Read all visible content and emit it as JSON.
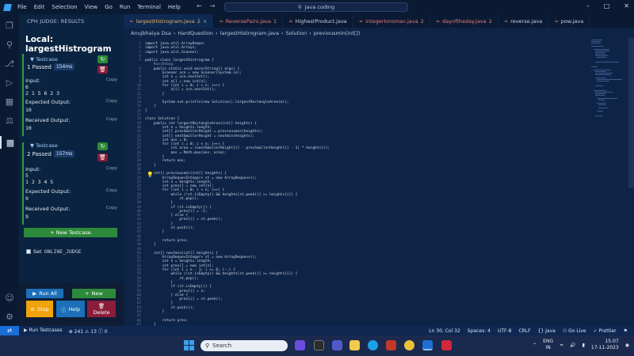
{
  "menu": [
    "File",
    "Edit",
    "Selection",
    "View",
    "Go",
    "Run",
    "Terminal",
    "Help"
  ],
  "search_text": "Java coding",
  "sidebar": {
    "header": "CPH JUDGE: RESULTS",
    "title": "Local: largestHistrogram",
    "testcases": [
      {
        "label": "Testcase",
        "status": "1 Passed",
        "time": "154ms",
        "input_label": "Input:",
        "input": [
          "6",
          "2 1 5 6 2 3"
        ],
        "expected_label": "Expected Output:",
        "expected": "10",
        "received_label": "Received Output:",
        "received": "10",
        "copy": "Copy"
      },
      {
        "label": "Testcase",
        "status": "2 Passed",
        "time": "157ms",
        "input_label": "Input:",
        "input": [
          "5",
          "1 2 3 4 5"
        ],
        "expected_label": "Expected Output:",
        "expected": "9",
        "received_label": "Received Output:",
        "received": "9",
        "copy": "Copy"
      }
    ],
    "new_testcase": "+ New Testcase",
    "set_label": "Set",
    "online_judge": "ONLINE_JUDGE",
    "run_all": "Run All",
    "new": "New",
    "stop": "Stop",
    "help": "Help",
    "delete": "Delete"
  },
  "tabs": [
    {
      "name": "largestHistrogram.java",
      "badge": "2",
      "color": "#e9b060",
      "active": true
    },
    {
      "name": "ReversePairs.java",
      "badge": "1",
      "color": "#e97a7a",
      "active": false
    },
    {
      "name": "HighestProduct.java",
      "badge": "",
      "color": "#c9d4e6",
      "active": false
    },
    {
      "name": "integertoroman.java",
      "badge": "2",
      "color": "#e97a7a",
      "active": false
    },
    {
      "name": "dayoftheday.java",
      "badge": "2",
      "color": "#e97a7a",
      "active": false
    },
    {
      "name": "reverse.java",
      "badge": "",
      "color": "#c9d4e6",
      "active": false
    },
    {
      "name": "pow.java",
      "badge": "",
      "color": "#c9d4e6",
      "active": false
    }
  ],
  "breadcrumbs": [
    "Anujbhaiya Dsa",
    "HardQuestion",
    "largestHistrogram.java",
    "Solution",
    "previousmin(int[])"
  ],
  "code_lines": [
    "import java.util.ArrayDeque;",
    "import java.util.Arrays;",
    "import java.util.Scanner;",
    "",
    "public class largestHistrogram {",
    "    Run|Debug",
    "    public static void main(String[] args) {",
    "        Scanner scn = new Scanner(System.in);",
    "        int n = scn.nextInt();",
    "        int a[] = new int[n];",
    "        for (int i = 0; i < n; i++) {",
    "            a[i] = scn.nextInt();",
    "        }",
    "",
    "        System.out.println(new Solution().largestRectangleArea(a));",
    "    }",
    "}",
    "",
    "class Solution {",
    "    public int largestRectangleArea(int[] heights) {",
    "        int n = heights.length;",
    "        int[] prevSmallerHeight = previousmin(heights);",
    "        int[] nextSmallerHeight = nextmin(heights);",
    "        int ans = 0;",
    "        for (int i = 0; i < n; i++) {",
    "            int area = (nextSmallerHeight[i] - prevSmallerHeight[i] - 1) * heights[i];",
    "            ans = Math.max(ans, area);",
    "        }",
    "        return ans;",
    "    }",
    "",
    "    int[] previousmin(int[] heights) {",
    "        ArrayDeque<Integer> st = new ArrayDeque<>();",
    "        int n = heights.length;",
    "        int prev[] = new int[n];",
    "        for (int i = 0; i < n; i++) {",
    "            while (!st.isEmpty() && heights[st.peek()] >= heights[i]) {",
    "                st.pop();",
    "            }",
    "            if (st.isEmpty()) {",
    "                prev[i] = -1;",
    "            } else {",
    "                prev[i] = st.peek();",
    "            }",
    "            st.push(i);",
    "        }",
    "",
    "        return prev;",
    "    }",
    "",
    "    int[] nextmin(int[] heights) {",
    "        ArrayDeque<Integer> st = new ArrayDeque<>();",
    "        int n = heights.length;",
    "        int prev[] = new int[n];",
    "        for (int i = n - 1; i >= 0; i--) {",
    "            while (!st.isEmpty() && heights[st.peek()] >= heights[i]) {",
    "                st.pop();",
    "            }",
    "            if (st.isEmpty()) {",
    "                prev[i] = n;",
    "            } else {",
    "                prev[i] = st.peek();",
    "            }",
    "            st.push(i);",
    "        }",
    "",
    "        return prev;",
    "    }",
    "}"
  ],
  "status": {
    "run_testcases": "Run Testcases",
    "errors": "241",
    "warnings": "13",
    "info": "0",
    "position": "Ln 30, Col 32",
    "spaces": "Spaces: 4",
    "encoding": "UTF-8",
    "eol": "CRLF",
    "language": "{} Java",
    "go_live": "Go Live",
    "prettier": "Prettier"
  },
  "taskbar": {
    "search": "Search",
    "lang1": "ENG",
    "lang2": "IN",
    "time": "15:07",
    "date": "17-11-2023"
  },
  "colors": {
    "accent_green": "#2e8a3a",
    "stop_orange": "#f0a30a",
    "help_blue": "#1c6fb8",
    "delete_red": "#8a1d3a"
  }
}
